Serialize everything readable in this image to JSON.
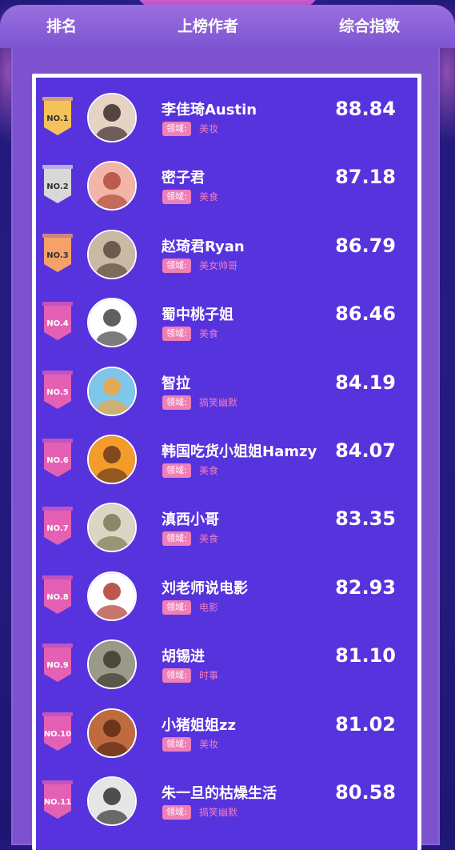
{
  "header": {
    "rank": "排名",
    "author": "上榜作者",
    "score": "综合指数"
  },
  "domain_label": "领域:",
  "colors": {
    "gold": "#f5c25a",
    "silver": "#d8d8d8",
    "bronze": "#f6a06a",
    "pink": "#e460b5"
  },
  "rows": [
    {
      "rank": "NO.1",
      "name": "李佳琦Austin",
      "domain": "美妆",
      "score": "88.84",
      "badge": "gold",
      "avatar_colors": [
        "#e7d3c4",
        "#3b2b2b"
      ],
      "avatar_icon": "person-avatar-icon"
    },
    {
      "rank": "NO.2",
      "name": "密子君",
      "domain": "美食",
      "score": "87.18",
      "badge": "silver",
      "avatar_colors": [
        "#f2b5a8",
        "#b14b3b"
      ],
      "avatar_icon": "person-avatar-icon"
    },
    {
      "rank": "NO.3",
      "name": "赵琦君Ryan",
      "domain": "美女帅哥",
      "score": "86.79",
      "badge": "bronze",
      "avatar_colors": [
        "#c9b9a5",
        "#5b4a3c"
      ],
      "avatar_icon": "person-avatar-icon"
    },
    {
      "rank": "NO.4",
      "name": "蜀中桃子姐",
      "domain": "美食",
      "score": "86.46",
      "badge": "pink",
      "avatar_colors": [
        "#ffffff",
        "#444444"
      ],
      "avatar_icon": "sketch-avatar-icon"
    },
    {
      "rank": "NO.5",
      "name": "智拉",
      "domain": "搞笑幽默",
      "score": "84.19",
      "badge": "pink",
      "avatar_colors": [
        "#7fc7ea",
        "#f1a640"
      ],
      "avatar_icon": "cartoon-avatar-icon"
    },
    {
      "rank": "NO.6",
      "name": "韩国吃货小姐姐Hamzy",
      "domain": "美食",
      "score": "84.07",
      "badge": "pink",
      "avatar_colors": [
        "#f39b2b",
        "#6b3b1c"
      ],
      "avatar_icon": "cartoon-avatar-icon"
    },
    {
      "rank": "NO.7",
      "name": "滇西小哥",
      "domain": "美食",
      "score": "83.35",
      "badge": "pink",
      "avatar_colors": [
        "#d9d7c4",
        "#7b7a56"
      ],
      "avatar_icon": "person-avatar-icon"
    },
    {
      "rank": "NO.8",
      "name": "刘老师说电影",
      "domain": "电影",
      "score": "82.93",
      "badge": "pink",
      "avatar_colors": [
        "#ffffff",
        "#b03a2e"
      ],
      "avatar_icon": "cartoon-avatar-icon"
    },
    {
      "rank": "NO.9",
      "name": "胡锡进",
      "domain": "时事",
      "score": "81.10",
      "badge": "pink",
      "avatar_colors": [
        "#9a9a88",
        "#3a3a30"
      ],
      "avatar_icon": "person-avatar-icon"
    },
    {
      "rank": "NO.10",
      "name": "小猪姐姐zz",
      "domain": "美妆",
      "score": "81.02",
      "badge": "pink",
      "avatar_colors": [
        "#c06b3e",
        "#5b2b15"
      ],
      "avatar_icon": "cartoon-avatar-icon"
    },
    {
      "rank": "NO.11",
      "name": "朱一旦的枯燥生活",
      "domain": "搞笑幽默",
      "score": "80.58",
      "badge": "pink",
      "avatar_colors": [
        "#e6e6e6",
        "#333333"
      ],
      "avatar_icon": "person-avatar-icon"
    }
  ]
}
